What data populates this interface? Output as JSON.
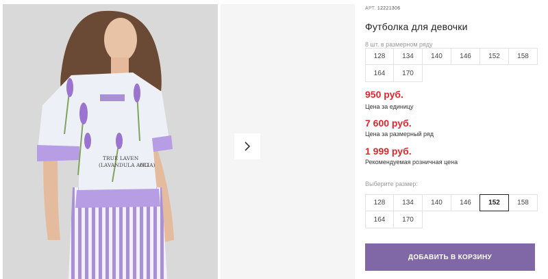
{
  "product": {
    "art_label": "АРТ.",
    "art_number": "12221306",
    "title": "Футболка для девочки",
    "printed_text": [
      "TRUE LAVEN",
      "(LAVANDULA ANG",
      "OLIA)"
    ]
  },
  "size_row": {
    "hint": "8 шт. в размерном ряду",
    "sizes": [
      "128",
      "134",
      "140",
      "146",
      "152",
      "158",
      "164",
      "170"
    ]
  },
  "prices": [
    {
      "value": "950 руб.",
      "label": "Цена за единицу"
    },
    {
      "value": "7 600 руб.",
      "label": "Цена за размерный ряд"
    },
    {
      "value": "1 999 руб.",
      "label": "Рекомендуемая розничная цена"
    }
  ],
  "size_select": {
    "hint": "Выберите размер:",
    "sizes": [
      "128",
      "134",
      "140",
      "146",
      "152",
      "158",
      "164",
      "170"
    ],
    "selected": "152"
  },
  "cart_button": {
    "label": "ДОБАВИТЬ В КОРЗИНУ"
  },
  "colors": {
    "price": "#e0262c",
    "button": "#8068a6",
    "accent_lavender": "#a98fd6"
  },
  "icons": {
    "next": "chevron-right-icon"
  }
}
